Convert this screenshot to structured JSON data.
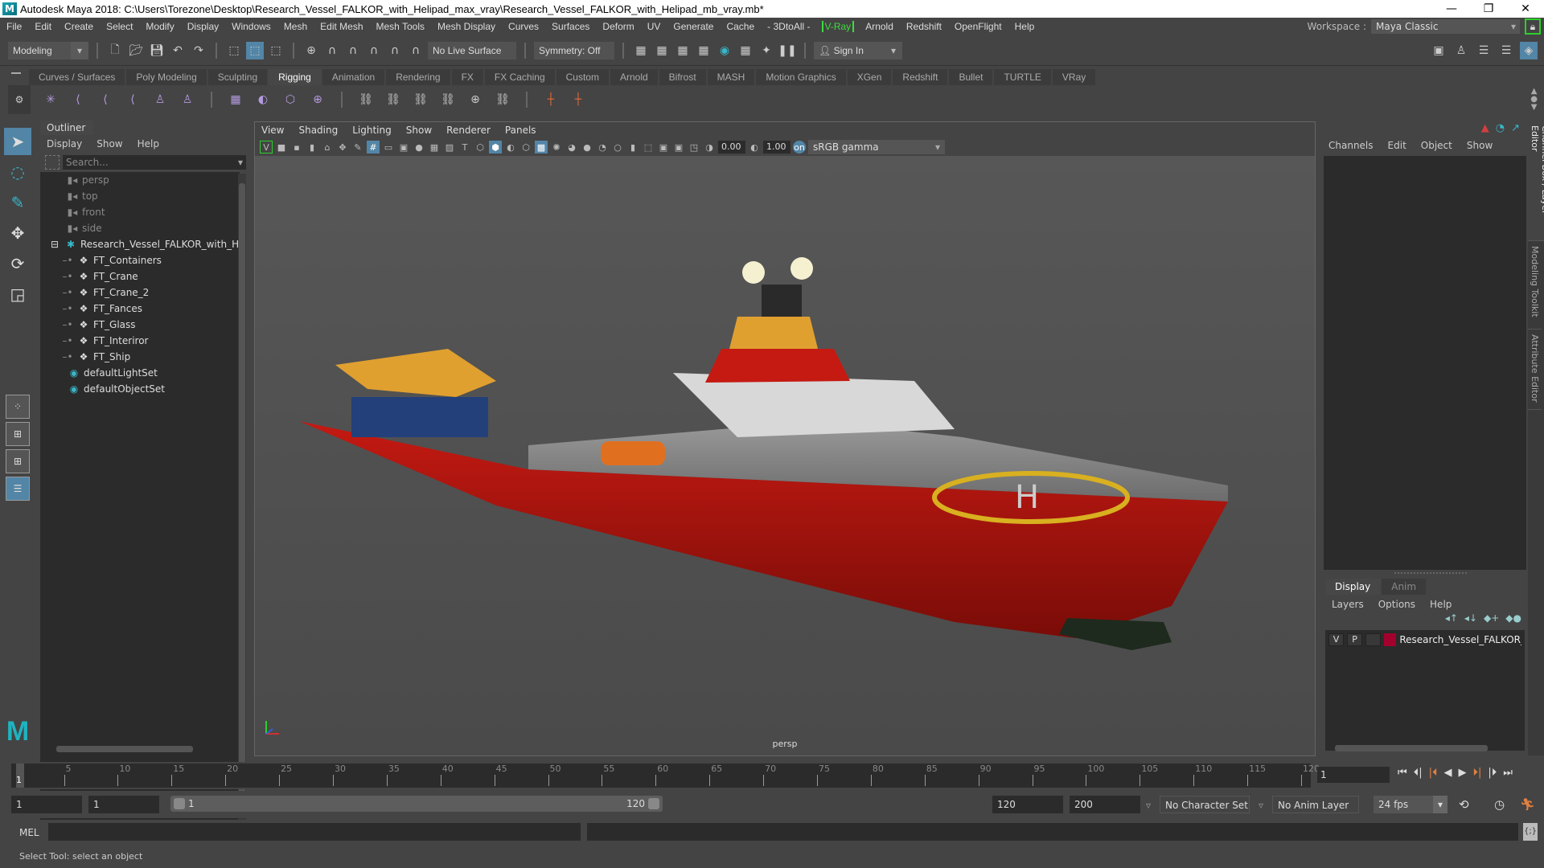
{
  "titlebar": {
    "title": "Autodesk Maya 2018: C:\\Users\\Torezone\\Desktop\\Research_Vessel_FALKOR_with_Helipad_max_vray\\Research_Vessel_FALKOR_with_Helipad_mb_vray.mb*",
    "minimize": "—",
    "restore": "❐",
    "close": "✕"
  },
  "menubar": {
    "items": [
      "File",
      "Edit",
      "Create",
      "Select",
      "Modify",
      "Display",
      "Windows",
      "Mesh",
      "Edit Mesh",
      "Mesh Tools",
      "Mesh Display",
      "Curves",
      "Surfaces",
      "Deform",
      "UV",
      "Generate",
      "Cache",
      "- 3DtoAll -",
      "V-Ray",
      "Arnold",
      "Redshift",
      "OpenFlight",
      "Help"
    ],
    "workspace_label": "Workspace :",
    "workspace_value": "Maya Classic"
  },
  "statusline": {
    "mode": "Modeling",
    "live_surface": "No Live Surface",
    "symmetry": "Symmetry: Off",
    "sign_in": "Sign In"
  },
  "shelf": {
    "tabs": [
      "Curves / Surfaces",
      "Poly Modeling",
      "Sculpting",
      "Rigging",
      "Animation",
      "Rendering",
      "FX",
      "FX Caching",
      "Custom",
      "Arnold",
      "Bifrost",
      "MASH",
      "Motion Graphics",
      "XGen",
      "Redshift",
      "Bullet",
      "TURTLE",
      "VRay"
    ],
    "active_tab": "Rigging"
  },
  "outliner": {
    "title": "Outliner",
    "menu": [
      "Display",
      "Show",
      "Help"
    ],
    "search_placeholder": "Search...",
    "items": [
      {
        "label": "persp",
        "type": "camera"
      },
      {
        "label": "top",
        "type": "camera"
      },
      {
        "label": "front",
        "type": "camera"
      },
      {
        "label": "side",
        "type": "camera"
      },
      {
        "label": "Research_Vessel_FALKOR_with_Helipad",
        "type": "group"
      },
      {
        "label": "FT_Containers",
        "type": "child"
      },
      {
        "label": "FT_Crane",
        "type": "child"
      },
      {
        "label": "FT_Crane_2",
        "type": "child"
      },
      {
        "label": "FT_Fances",
        "type": "child"
      },
      {
        "label": "FT_Glass",
        "type": "child"
      },
      {
        "label": "FT_Interiror",
        "type": "child"
      },
      {
        "label": "FT_Ship",
        "type": "child"
      },
      {
        "label": "defaultLightSet",
        "type": "set"
      },
      {
        "label": "defaultObjectSet",
        "type": "set"
      }
    ]
  },
  "viewport": {
    "menu": [
      "View",
      "Shading",
      "Lighting",
      "Show",
      "Renderer",
      "Panels"
    ],
    "exposure": "0.00",
    "gamma": "1.00",
    "color_space": "sRGB gamma",
    "camera_label": "persp"
  },
  "channelbox": {
    "menu": [
      "Channels",
      "Edit",
      "Object",
      "Show"
    ]
  },
  "layereditor": {
    "tabs": [
      "Display",
      "Anim"
    ],
    "active_tab": "Display",
    "menu": [
      "Layers",
      "Options",
      "Help"
    ],
    "layers": [
      {
        "v": "V",
        "p": "P",
        "name": "Research_Vessel_FALKOR_with_Helipad",
        "color": "#a3002d"
      }
    ]
  },
  "sidetabs": [
    "Channel Box / Layer Editor",
    "Modeling Toolkit",
    "Attribute Editor"
  ],
  "timeline": {
    "current_marker": "1",
    "ticks": [
      5,
      10,
      15,
      20,
      25,
      30,
      35,
      40,
      45,
      50,
      55,
      60,
      65,
      70,
      75,
      80,
      85,
      90,
      95,
      100,
      105,
      110,
      115,
      120
    ],
    "start": 1,
    "end": 120,
    "current_frame": "1"
  },
  "range": {
    "start": "1",
    "playback_start": "1",
    "slider_start": "1",
    "slider_end": "120",
    "playback_end": "120",
    "end": "200",
    "character_set": "No Character Set",
    "anim_layer": "No Anim Layer",
    "fps": "24 fps"
  },
  "cmdline": {
    "label": "MEL"
  },
  "status": {
    "message": "Select Tool: select an object"
  }
}
